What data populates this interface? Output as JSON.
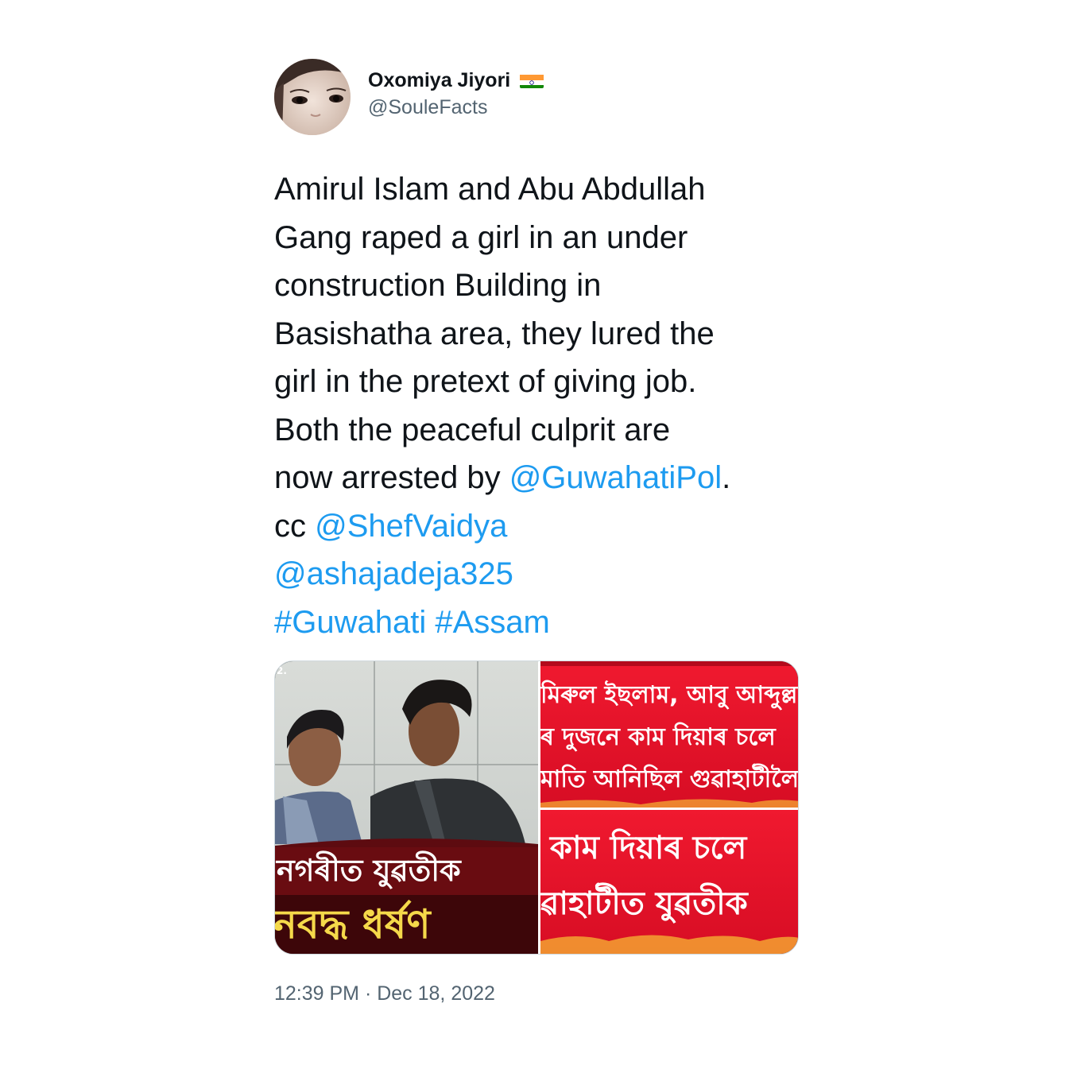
{
  "tweet": {
    "author": {
      "name": "Oxomiya Jiyori",
      "handle": "@SouleFacts",
      "flag_icon": "india-flag-icon"
    },
    "text_lines": [
      "Amirul Islam and Abu Abdullah",
      "Gang raped a girl in an under",
      "construction Building in",
      "Basishatha area, they lured the",
      "girl in the pretext of giving job.",
      "Both the peaceful culprit are"
    ],
    "line7_prefix": "now arrested by ",
    "mention_police": "@GuwahatiPol",
    "line7_suffix": ".",
    "cc_prefix": "cc ",
    "mention_shef": "@ShefVaidya",
    "mention_asha": "@ashajadeja325",
    "hashtag_guwahati": "#Guwahati",
    "hashtag_assam": "#Assam",
    "media": {
      "left_caption_line1": "নগৰীত যুৱতীক",
      "left_caption_line2": "নবদ্ধ ধৰ্ষণ",
      "corner_mark": "2.",
      "right_top_line1": "মিৰুল ইছলাম, আবু আব্দুল্লা",
      "right_top_line2": "ৰ দুজনে কাম দিয়াৰ চলে",
      "right_top_line3": "মাতি আনিছিল গুৱাহাটীলৈ",
      "right_bottom_line1": "কাম দিয়াৰ চলে",
      "right_bottom_line2": "ৱাহাটীত যুৱতীক"
    },
    "timestamp": "12:39 PM · Dec 18, 2022"
  },
  "colors": {
    "link": "#1d9bf0",
    "secondary_text": "#536471",
    "primary_text": "#0f1419",
    "banner_red": "#e8132a",
    "banner_text_yellow": "#f5d94a"
  }
}
